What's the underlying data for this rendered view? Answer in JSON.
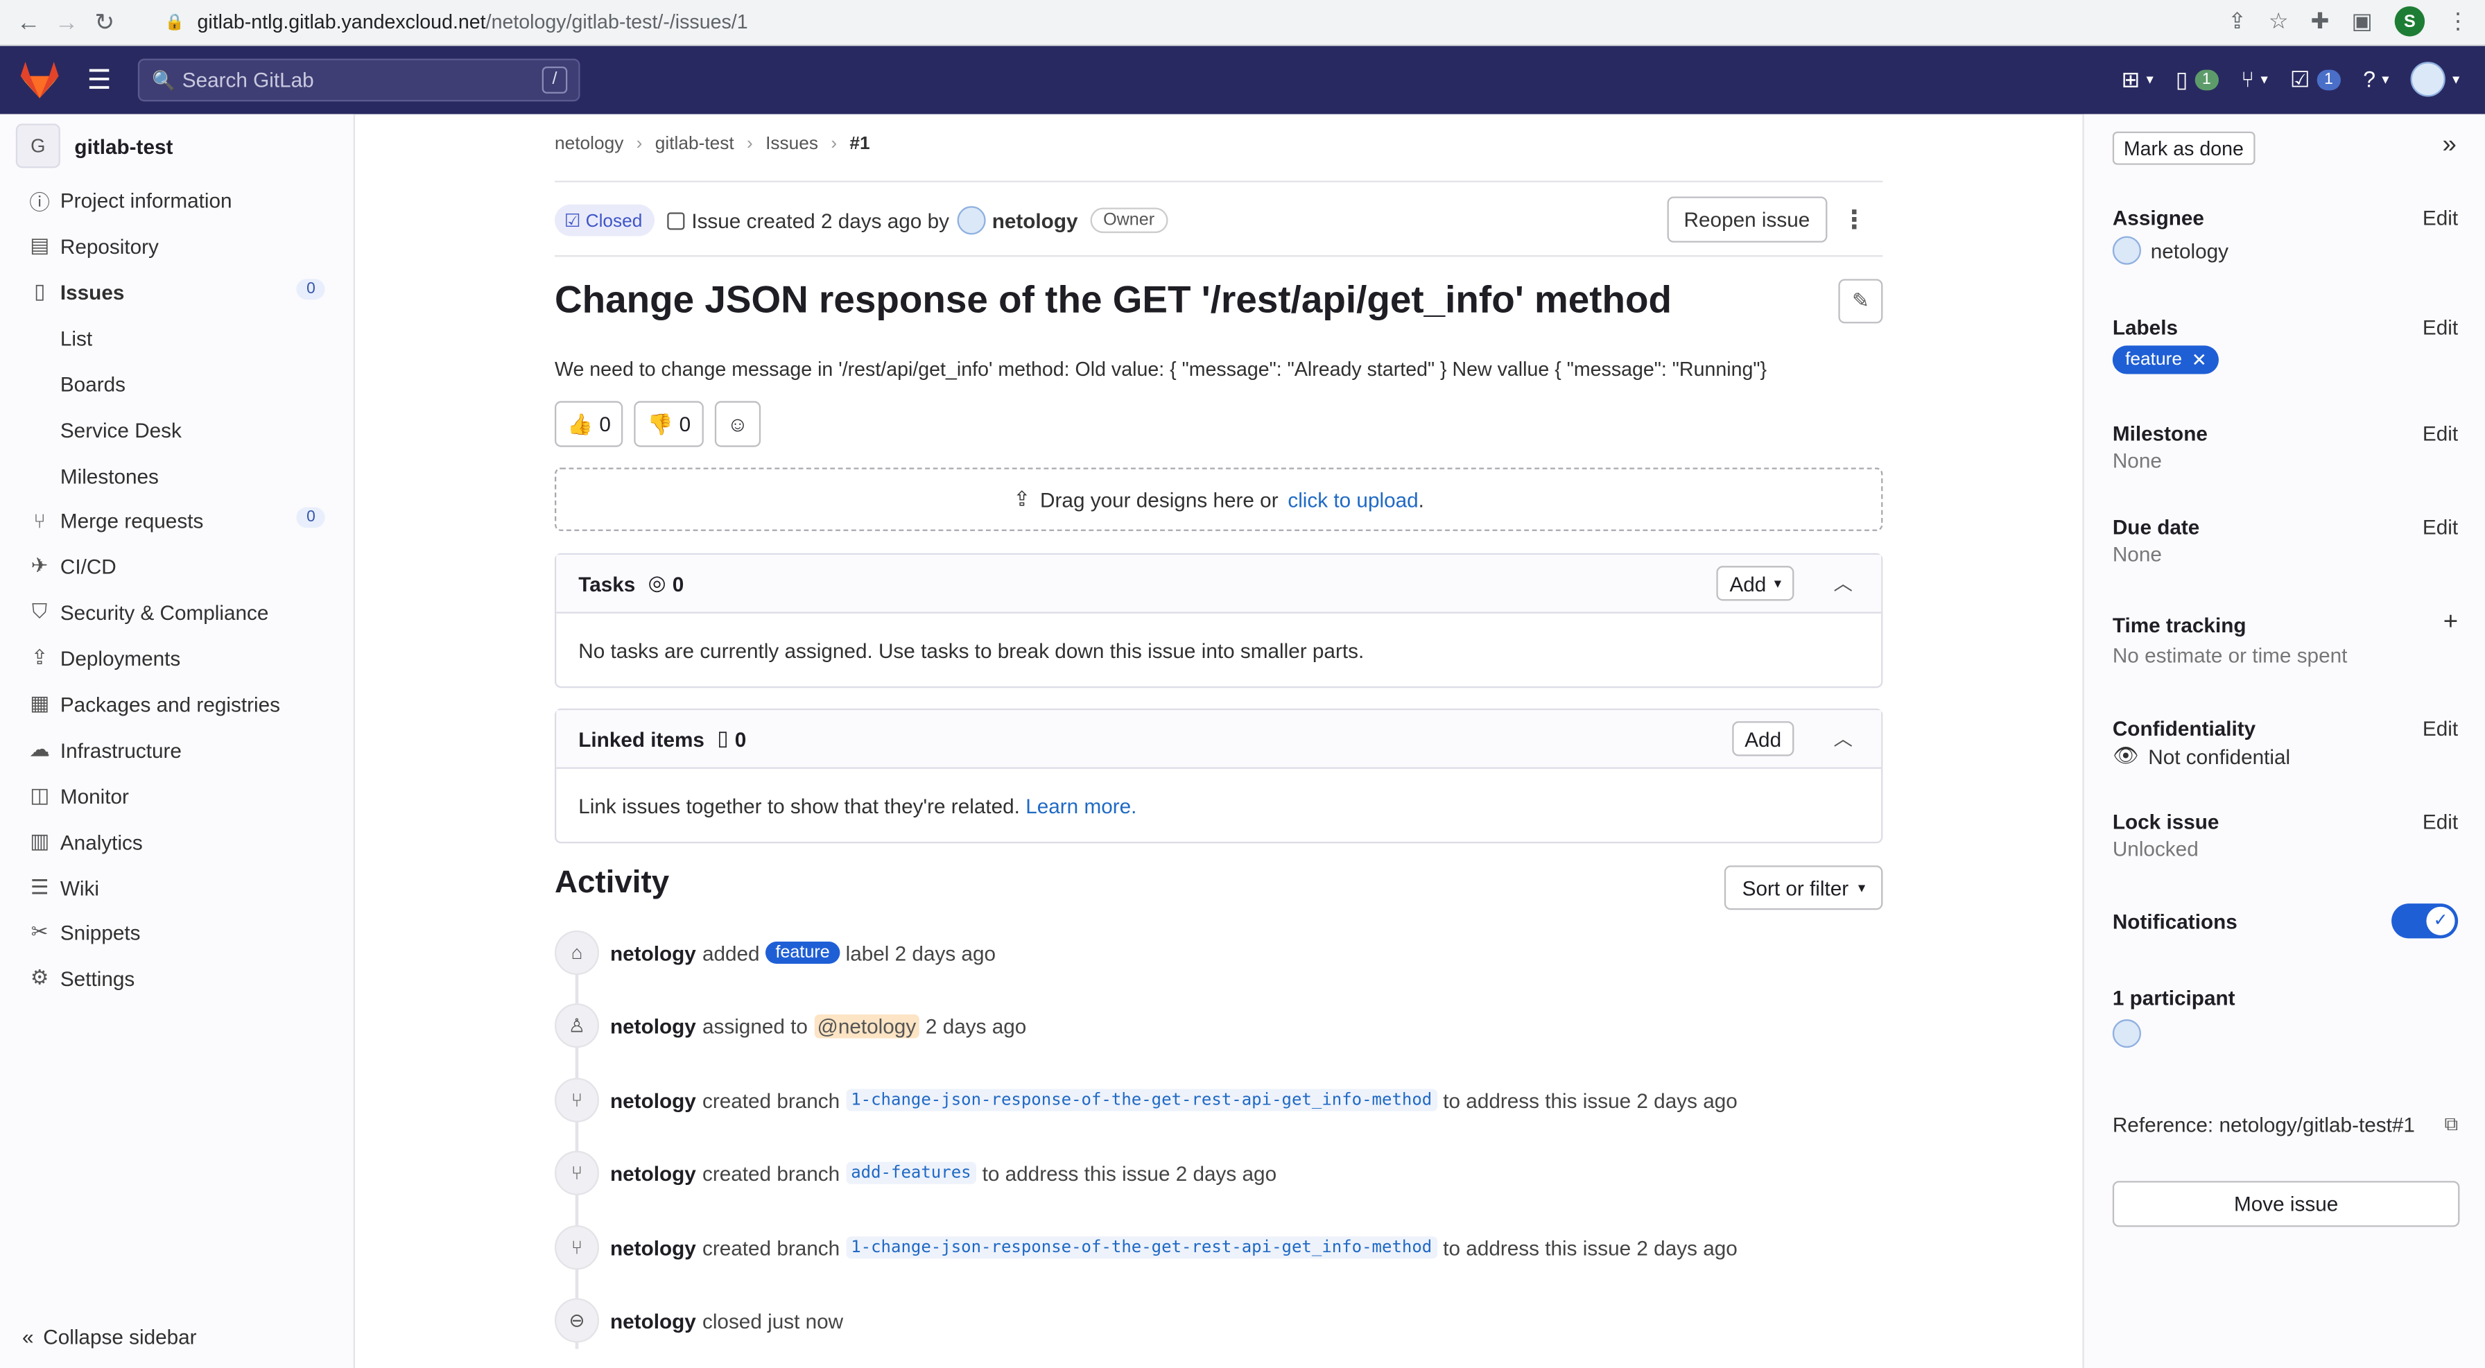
{
  "browser": {
    "url_host": "gitlab-ntlg.gitlab.yandexcloud.net",
    "url_path": "/netology/gitlab-test/-/issues/1",
    "profile_initial": "S"
  },
  "topnav": {
    "search_placeholder": "Search GitLab",
    "search_shortcut": "/",
    "issues_count": "1",
    "todos_count": "1"
  },
  "sidebar": {
    "project_initial": "G",
    "project_name": "gitlab-test",
    "items": [
      {
        "label": "Project information",
        "icon": "info-icon"
      },
      {
        "label": "Repository",
        "icon": "doc-icon"
      },
      {
        "label": "Issues",
        "icon": "issues-icon",
        "count": "0"
      },
      {
        "label": "List"
      },
      {
        "label": "Boards"
      },
      {
        "label": "Service Desk"
      },
      {
        "label": "Milestones"
      },
      {
        "label": "Merge requests",
        "icon": "merge-icon",
        "count": "0"
      },
      {
        "label": "CI/CD",
        "icon": "rocket-icon"
      },
      {
        "label": "Security & Compliance",
        "icon": "shield-icon"
      },
      {
        "label": "Deployments",
        "icon": "deploy-icon"
      },
      {
        "label": "Packages and registries",
        "icon": "package-icon"
      },
      {
        "label": "Infrastructure",
        "icon": "cloud-icon"
      },
      {
        "label": "Monitor",
        "icon": "monitor-icon"
      },
      {
        "label": "Analytics",
        "icon": "chart-icon"
      },
      {
        "label": "Wiki",
        "icon": "book-icon"
      },
      {
        "label": "Snippets",
        "icon": "scissors-icon"
      },
      {
        "label": "Settings",
        "icon": "gear-icon"
      }
    ],
    "collapse_label": "Collapse sidebar"
  },
  "breadcrumbs": [
    "netology",
    "gitlab-test",
    "Issues",
    "#1"
  ],
  "issue": {
    "status": "Closed",
    "created_text": "Issue created 2 days ago by",
    "author": "netology",
    "author_role": "Owner",
    "reopen_label": "Reopen issue",
    "title": "Change JSON response of the GET '/rest/api/get_info' method",
    "description": "We need to change message in '/rest/api/get_info' method: Old value: { \"message\": \"Already started\" } New vallue { \"message\": \"Running\"}",
    "thumbs_up": "0",
    "thumbs_down": "0"
  },
  "dropzone": {
    "text": "Drag your designs here or",
    "link": "click to upload",
    "suffix": "."
  },
  "tasks": {
    "title": "Tasks",
    "count": "0",
    "add_label": "Add",
    "empty_text": "No tasks are currently assigned. Use tasks to break down this issue into smaller parts."
  },
  "linked": {
    "title": "Linked items",
    "count": "0",
    "add_label": "Add",
    "empty_text": "Link issues together to show that they're related.",
    "learn_more": "Learn more."
  },
  "activity": {
    "title": "Activity",
    "sort_label": "Sort or filter",
    "items": [
      {
        "user": "netology",
        "pre": "added",
        "pill": "feature",
        "post": "label 2 days ago"
      },
      {
        "user": "netology",
        "pre": "assigned to",
        "mention": "@netology",
        "post": "2 days ago"
      },
      {
        "user": "netology",
        "pre": "created branch",
        "code": "1-change-json-response-of-the-get-rest-api-get_info-method",
        "post": "to address this issue 2 days ago"
      },
      {
        "user": "netology",
        "pre": "created branch",
        "code": "add-features",
        "post": "to address this issue 2 days ago"
      },
      {
        "user": "netology",
        "pre": "created branch",
        "code": "1-change-json-response-of-the-get-rest-api-get_info-method",
        "post": "to address this issue 2 days ago"
      },
      {
        "user": "netology",
        "pre": "closed just now"
      }
    ]
  },
  "right_sidebar": {
    "mark_done": "Mark as done",
    "assignee_title": "Assignee",
    "assignee_value": "netology",
    "labels_title": "Labels",
    "label_value": "feature",
    "milestone_title": "Milestone",
    "milestone_value": "None",
    "due_title": "Due date",
    "due_value": "None",
    "time_title": "Time tracking",
    "time_value": "No estimate or time spent",
    "conf_title": "Confidentiality",
    "conf_value": "Not confidential",
    "lock_title": "Lock issue",
    "lock_value": "Unlocked",
    "notif_title": "Notifications",
    "notifications_on": true,
    "participants_title": "1 participant",
    "reference_text": "Reference: netology/gitlab-test#1",
    "move_label": "Move issue",
    "edit_label": "Edit"
  }
}
